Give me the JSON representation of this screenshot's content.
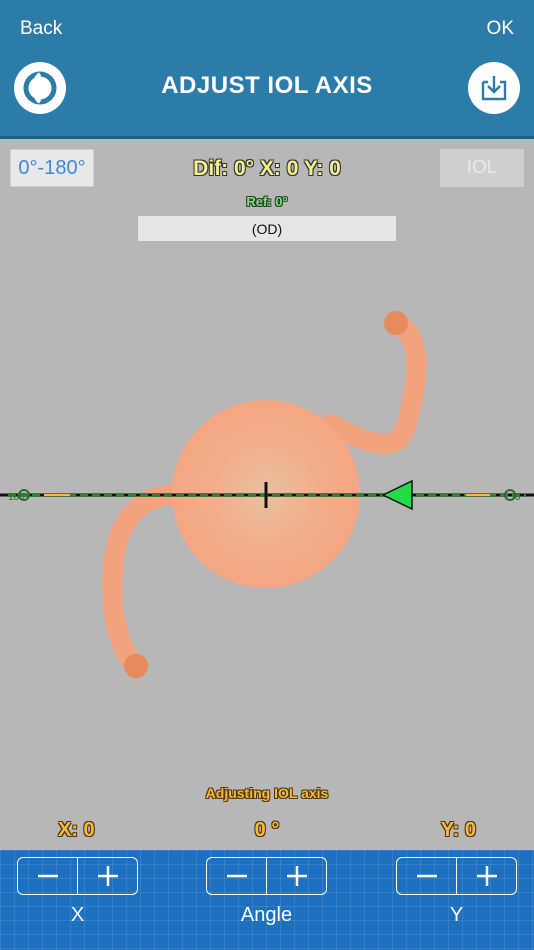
{
  "nav": {
    "back_label": "Back",
    "ok_label": "OK"
  },
  "header": {
    "title": "ADJUST IOL AXIS"
  },
  "toolbar": {
    "range_label": "0°-180°",
    "iol_label": "IOL"
  },
  "info": {
    "difference": "Dif: 0° X: 0 Y: 0",
    "reference": "Ref: 0°",
    "eye": "(OD)"
  },
  "axis": {
    "angle_deg": 0,
    "scale_left_label": "180",
    "scale_right_label": "0"
  },
  "status": {
    "message": "Adjusting IOL axis"
  },
  "readouts": {
    "x": "X: 0",
    "angle": "0 °",
    "y": "Y: 0"
  },
  "controls": {
    "x": {
      "label": "X",
      "minus": "−",
      "plus": "+"
    },
    "angle": {
      "label": "Angle",
      "minus": "−",
      "plus": "+"
    },
    "y": {
      "label": "Y",
      "minus": "−",
      "plus": "+"
    }
  },
  "colors": {
    "header": "#2b7ca8",
    "control_bar": "#1d6fc0",
    "readout": "#ffb63a",
    "info_text": "#f2ef8e",
    "ref_text": "#7fe07a",
    "axis_marker": "#22dd44",
    "lens": "#f2a27c"
  },
  "icons": {
    "logo": "app-logo-icon",
    "download": "download-icon",
    "minus": "minus-icon",
    "plus": "plus-icon"
  }
}
